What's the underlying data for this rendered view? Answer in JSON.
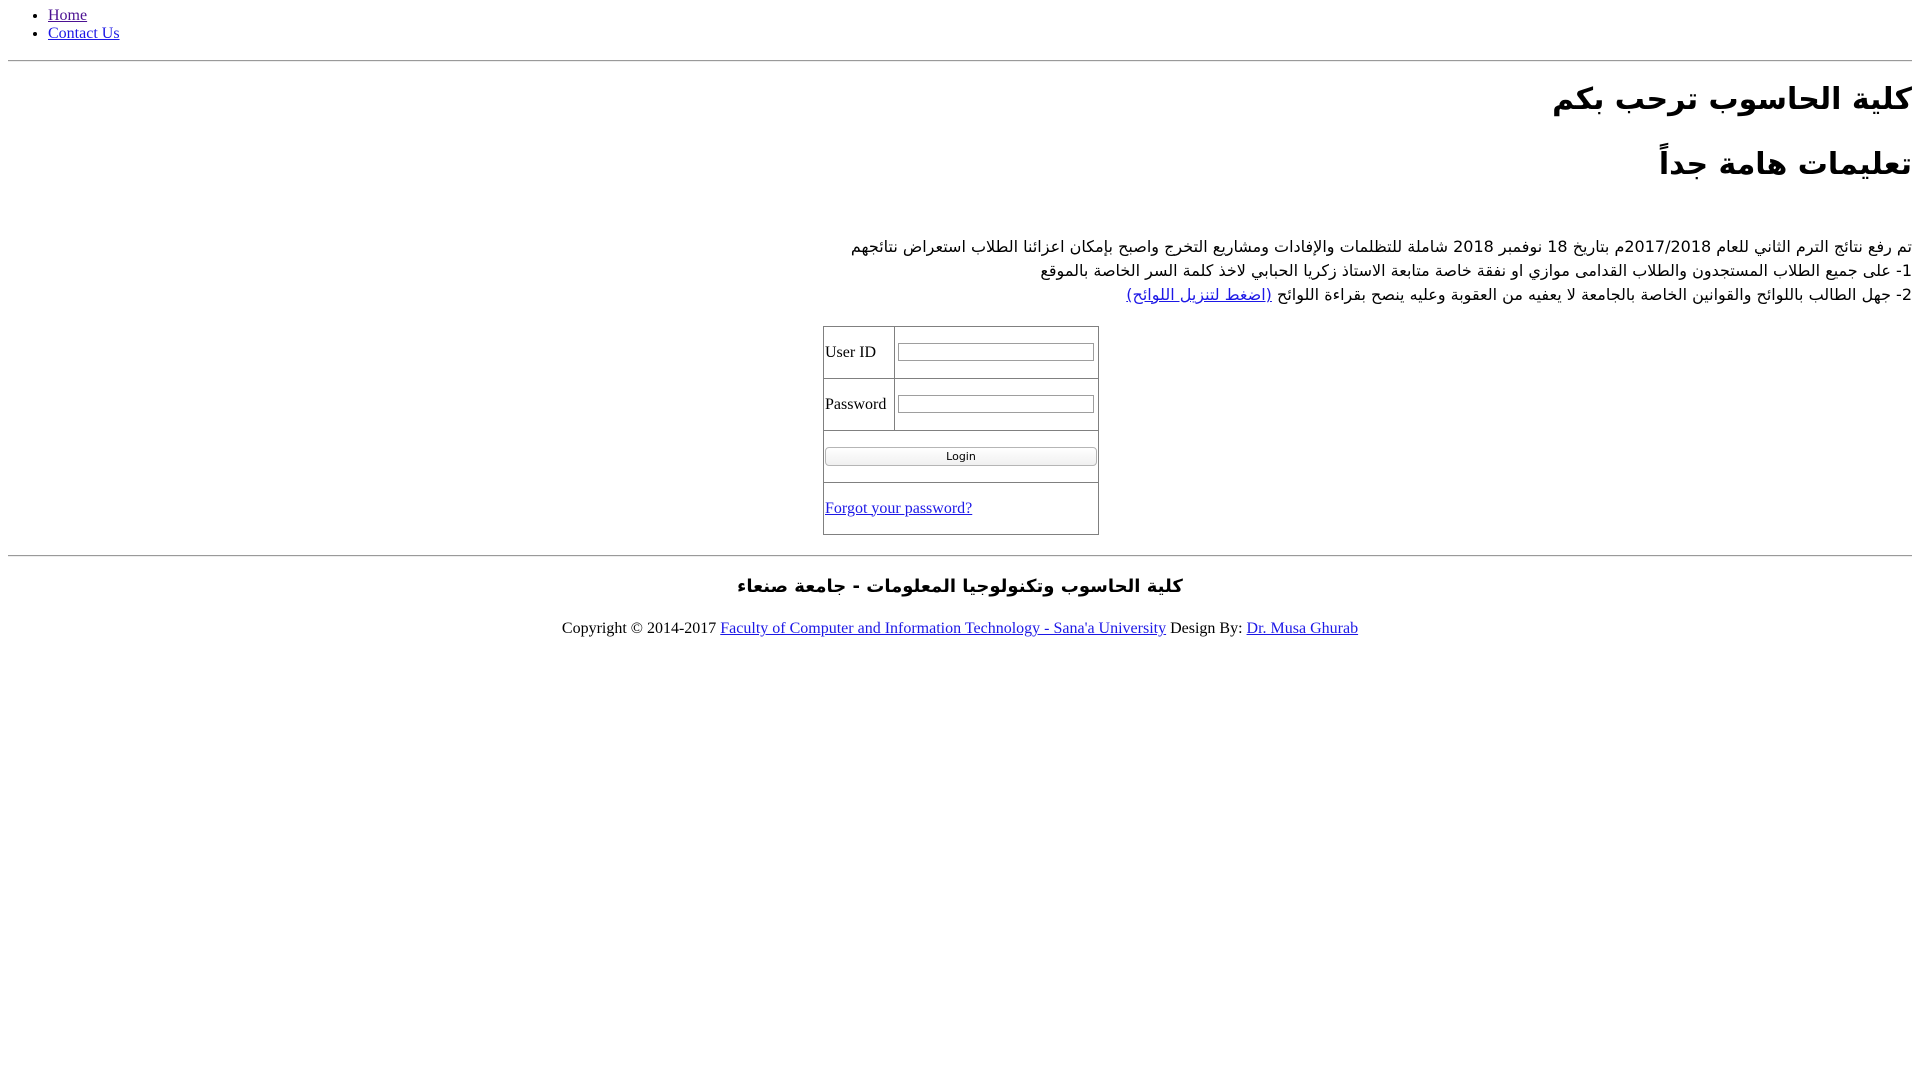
{
  "nav": {
    "items": [
      {
        "label": "Home"
      },
      {
        "label": "Contact Us"
      }
    ]
  },
  "header": {
    "welcome_title": "كلية الحاسوب ترحب بكم",
    "instructions_title": "تعليمات هامة جداً"
  },
  "notice": {
    "line1": "تم رفع نتائج الترم الثاني للعام 2017/2018م بتاريخ 18 نوفمبر 2018 شاملة للتظلمات والإفادات ومشاريع التخرج واصبح بإمكان اعزائنا الطلاب استعراض نتائجهم",
    "line2": "1- على جميع الطلاب المستجدون والطلاب القدامى موازي او نفقة خاصة متابعة الاستاذ زكريا الحبابي لاخذ كلمة السر الخاصة بالموقع",
    "line3_text": "2- جهل الطالب باللوائح والقوانين الخاصة بالجامعة لا يعفيه من العقوبة وعليه ينصح بقراءة اللوائح ",
    "line3_link": "(اضغط لتنزيل اللوائح)"
  },
  "login": {
    "user_id_label": "User ID",
    "user_id_value": "",
    "password_label": "Password",
    "password_value": "",
    "login_button": "Login",
    "forgot_link": "Forgot your password?"
  },
  "footer": {
    "college_name_ar": "كلية الحاسوب وتكنولوجيا المعلومات - جامعة صنعاء",
    "copyright_prefix": "Copyright © 2014-2017 ",
    "faculty_link": "Faculty of Computer and Information Technology - Sana'a University",
    "design_by": " Design By: ",
    "designer_link": "Dr. Musa Ghurab"
  },
  "colors": {
    "visited_link": "#4b1192",
    "link": "#1d18e6",
    "rule": "#9a9a9a",
    "table_border": "#808080"
  }
}
